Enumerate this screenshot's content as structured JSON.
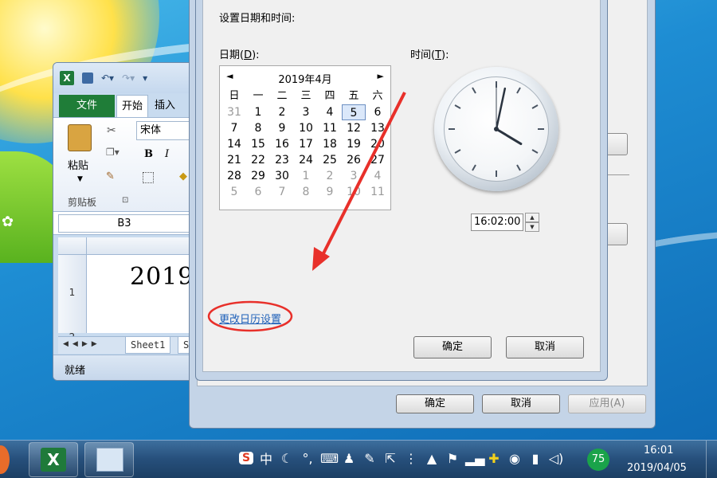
{
  "excel": {
    "tabs": {
      "file": "文件",
      "home": "开始",
      "insert": "插入"
    },
    "ribbon": {
      "paste": "粘贴",
      "clipboard_group": "剪贴板",
      "font_name": "宋体",
      "bold": "B",
      "italic": "I"
    },
    "name_box": "B3",
    "row1": "1",
    "row2": "2",
    "cell_value": "2019",
    "sheet_tab": "Sheet1",
    "sheet_tab_partial": "S",
    "status": "就绪"
  },
  "dialog": {
    "heading": "设置日期和时间:",
    "date_label": "日期(",
    "date_hotkey": "D",
    "date_label_end": "):",
    "time_label": "时间(",
    "time_hotkey": "T",
    "time_label_end": "):",
    "calendar": {
      "month": "2019年4月",
      "prev": "◄",
      "next": "►",
      "weekdays": [
        "日",
        "一",
        "二",
        "三",
        "四",
        "五",
        "六"
      ],
      "days": [
        [
          "31",
          "1",
          "2",
          "3",
          "4",
          "5",
          "6"
        ],
        [
          "7",
          "8",
          "9",
          "10",
          "11",
          "12",
          "13"
        ],
        [
          "14",
          "15",
          "16",
          "17",
          "18",
          "19",
          "20"
        ],
        [
          "21",
          "22",
          "23",
          "24",
          "25",
          "26",
          "27"
        ],
        [
          "28",
          "29",
          "30",
          "1",
          "2",
          "3",
          "4"
        ],
        [
          "5",
          "6",
          "7",
          "8",
          "9",
          "10",
          "11"
        ]
      ],
      "selected": "5"
    },
    "clock": {
      "hour": 16,
      "minute": 2,
      "second": 0
    },
    "time_value": "16:02:00",
    "change_calendar_link": "更改日历设置",
    "ok": "确定",
    "cancel": "取消"
  },
  "back_dialog": {
    "ok": "确定",
    "cancel": "取消",
    "apply": "应用(A)"
  },
  "taskbar": {
    "ime_icon": "S",
    "ime_zh": "中",
    "tray_icons": [
      "moon-icon",
      "punctuation-icon",
      "keyboard-icon",
      "user-icon",
      "wrench-icon",
      "share-icon",
      "chevron-icon",
      "arrow-up-icon",
      "bell-icon",
      "signal-icon",
      "plus-icon",
      "qq-icon",
      "battery-icon",
      "volume-icon"
    ],
    "badge": "75",
    "time": "16:01",
    "date": "2019/04/05"
  },
  "colors": {
    "annotation": "#e8302a",
    "link": "#1d5fb8",
    "excel_green": "#1f7d38"
  }
}
